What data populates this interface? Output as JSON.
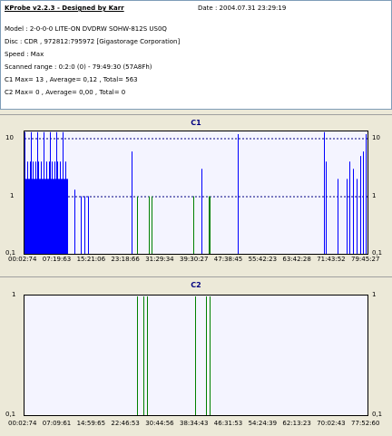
{
  "header": {
    "title": "KProbe v2.2.3 - Designed by Karr",
    "date": "Date : 2004.07.31 23:29:19",
    "model": "Model : 2-0-0-0 LITE-ON DVDRW SOHW-812S  US0Q",
    "disc": "Disc : CDR , 972812:795972 [Gigastorage Corporation]",
    "speed": "Speed : Max",
    "range": "Scanned range : 0:2:0 (0) - 79:49:30 (57A8Fh)",
    "c1": "C1 Max= 13 , Average= 0,12 , Total= 563",
    "c2": "C2 Max= 0 , Average= 0,00 , Total= 0"
  },
  "c1_chart": {
    "title": "C1",
    "y_ticks_left": [
      "10",
      "1",
      "0,1"
    ],
    "y_ticks_right": [
      "10",
      "1",
      "0,1"
    ],
    "x_ticks": [
      "00:02:74",
      "07:19:63",
      "15:21:06",
      "23:18:66",
      "31:29:34",
      "39:30:27",
      "47:38:45",
      "55:42:23",
      "63:42:28",
      "71:43:52",
      "79:45:27"
    ]
  },
  "c2_chart": {
    "title": "C2",
    "y_ticks_left": [
      "1",
      "0,1"
    ],
    "y_ticks_right": [
      "1",
      "0,1"
    ],
    "x_ticks": [
      "00:02:74",
      "07:09:61",
      "14:59:65",
      "22:46:53",
      "30:44:56",
      "38:34:43",
      "46:31:53",
      "54:24:39",
      "62:13:23",
      "70:02:43",
      "77:52:60"
    ]
  },
  "colors": {
    "c1_bars": "#0000ff",
    "c2_bars": "#008000",
    "grid": "#000080"
  }
}
